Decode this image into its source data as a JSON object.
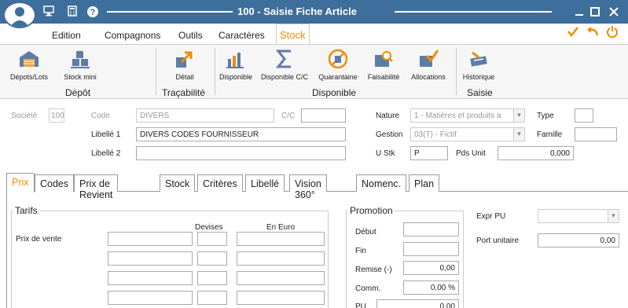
{
  "window": {
    "title": "100 - Saisie Fiche Article",
    "minimize": "–",
    "maximize": "□",
    "close": "✕"
  },
  "titlebar_icons": [
    "user-avatar-icon",
    "monitor-icon",
    "calculator-icon",
    "help-icon"
  ],
  "menu": {
    "items": [
      "Edition",
      "Compagnons",
      "Outils",
      "Caractères",
      "Stock"
    ],
    "active": "Stock",
    "quick_actions": {
      "validate": "✓",
      "undo": "↶",
      "power": "⏻"
    }
  },
  "ribbon": {
    "depot": {
      "group_label": "Dépôt",
      "buttons": [
        "Dépots/Lots",
        "Stock mini"
      ]
    },
    "tracabilite": {
      "group_label": "Traçabilité",
      "buttons": [
        "Détail"
      ]
    },
    "disponible": {
      "group_label": "Disponible",
      "buttons": [
        "Disponible",
        "Disponible C/C",
        "Quarantaine",
        "Faisabilité",
        "Allocations"
      ]
    },
    "saisie": {
      "group_label": "Saisie",
      "buttons": [
        "Historique"
      ]
    }
  },
  "header": {
    "societe_label": "Société",
    "societe_value": "100",
    "code_label": "Code",
    "code_value": "DIVERS",
    "cc_label": "C/C",
    "cc_value": "",
    "libelle1_label": "Libellé 1",
    "libelle1_value": "DIVERS CODES FOURNISSEUR",
    "libelle2_label": "Libellé 2",
    "libelle2_value": "",
    "nature_label": "Nature",
    "nature_value": "1 - Matières et produits a",
    "gestion_label": "Gestion",
    "gestion_value": "03(T) - Fictif",
    "ustk_label": "U Stk",
    "ustk_value": "P",
    "pdsunit_label": "Pds Unit",
    "pdsunit_value": "0,000",
    "type_label": "Type",
    "type_value": "",
    "famille_label": "Famille",
    "famille_value": ""
  },
  "tabs": [
    "Prix",
    "Codes",
    "Prix de Revient",
    "Stock",
    "Critères",
    "Libellé",
    "Vision 360°",
    "Nomenc.",
    "Plan"
  ],
  "active_tab": "Prix",
  "prix": {
    "tarifs_title": "Tarifs",
    "col_devises": "Devises",
    "col_euro": "En Euro",
    "prix_vente_label": "Prix de vente",
    "promotion_title": "Promotion",
    "debut_label": "Début",
    "debut_value": "",
    "fin_label": "Fin",
    "fin_value": "",
    "remise_label": "Remise (-)",
    "remise_value": "0,00",
    "comm_label": "Comm.",
    "comm_value": "0,00 %",
    "pu_label": "PU",
    "pu_value": "0,00",
    "expr_pu_label": "Expr PU",
    "expr_pu_value": "",
    "port_unitaire_label": "Port unitaire",
    "port_unitaire_value": "0,00"
  },
  "colors": {
    "titlebar": "#3e6e9b",
    "accent": "#f08c00"
  }
}
